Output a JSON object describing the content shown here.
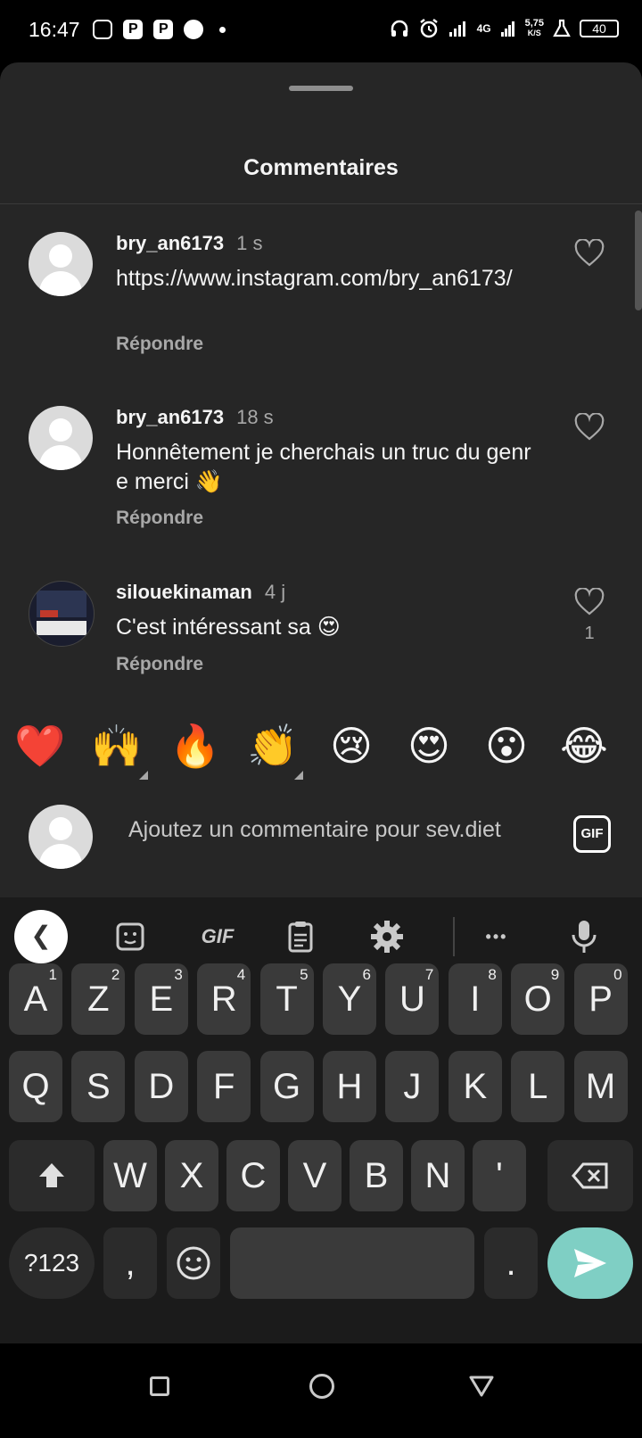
{
  "status_bar": {
    "time": "16:47",
    "network": "4G",
    "speed": "5,75",
    "speed_unit": "K/S",
    "battery": "40"
  },
  "sheet": {
    "title": "Commentaires"
  },
  "comments": [
    {
      "username": "bry_an6173",
      "time": "1 s",
      "text": "https://www.instagram.com/bry_an6173/",
      "reply": "Répondre",
      "likes": ""
    },
    {
      "username": "bry_an6173",
      "time": "18 s",
      "text": "Honnêtement je cherchais un truc du genre merci 👋",
      "reply": "Répondre",
      "likes": ""
    },
    {
      "username": "silouekinaman",
      "time": "4 j",
      "text": "C'est intéressant sa 😍",
      "reply": "Répondre",
      "likes": "1"
    }
  ],
  "quick_reactions": [
    "❤️",
    "🙌",
    "🔥",
    "👏",
    "😢",
    "😍",
    "😮",
    "😂"
  ],
  "composer": {
    "placeholder": "Ajoutez un commentaire pour sev.diet",
    "gif_label": "GIF"
  },
  "keyboard": {
    "toolbar": {
      "gif_label": "GIF",
      "more_label": "•••"
    },
    "row1": [
      {
        "k": "A",
        "n": "1"
      },
      {
        "k": "Z",
        "n": "2"
      },
      {
        "k": "E",
        "n": "3"
      },
      {
        "k": "R",
        "n": "4"
      },
      {
        "k": "T",
        "n": "5"
      },
      {
        "k": "Y",
        "n": "6"
      },
      {
        "k": "U",
        "n": "7"
      },
      {
        "k": "I",
        "n": "8"
      },
      {
        "k": "O",
        "n": "9"
      },
      {
        "k": "P",
        "n": "0"
      }
    ],
    "row2": [
      "Q",
      "S",
      "D",
      "F",
      "G",
      "H",
      "J",
      "K",
      "L",
      "M"
    ],
    "row3": [
      "W",
      "X",
      "C",
      "V",
      "B",
      "N",
      "'"
    ],
    "symbols_label": "?123",
    "comma_label": ",",
    "period_label": "."
  }
}
